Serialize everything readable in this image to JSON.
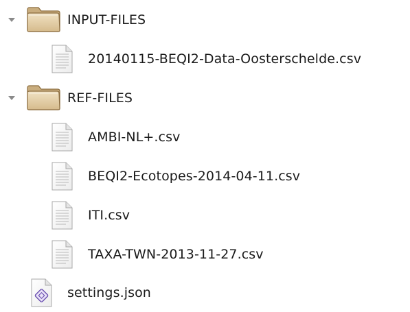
{
  "tree": {
    "items": [
      {
        "label": "INPUT-FILES",
        "type": "folder",
        "expanded": true,
        "icon": "folder-icon"
      },
      {
        "label": "20140115-BEQI2-Data-Oosterschelde.csv",
        "type": "file",
        "icon": "text-file-icon"
      },
      {
        "label": "REF-FILES",
        "type": "folder",
        "expanded": true,
        "icon": "folder-icon"
      },
      {
        "label": "AMBI-NL+.csv",
        "type": "file",
        "icon": "text-file-icon"
      },
      {
        "label": "BEQI2-Ecotopes-2014-04-11.csv",
        "type": "file",
        "icon": "text-file-icon"
      },
      {
        "label": "ITI.csv",
        "type": "file",
        "icon": "text-file-icon"
      },
      {
        "label": "TAXA-TWN-2013-11-27.csv",
        "type": "file",
        "icon": "text-file-icon"
      },
      {
        "label": "settings.json",
        "type": "file",
        "icon": "json-file-icon"
      }
    ]
  },
  "colors": {
    "folder_body": "#d9c29a",
    "folder_tab": "#c9ad7e",
    "folder_edge": "#8c6d3f",
    "file_page": "#f7f7f7",
    "file_edge": "#a8a8a8",
    "expander": "#8a8a8a",
    "json_badge": "#6a4fb0"
  }
}
